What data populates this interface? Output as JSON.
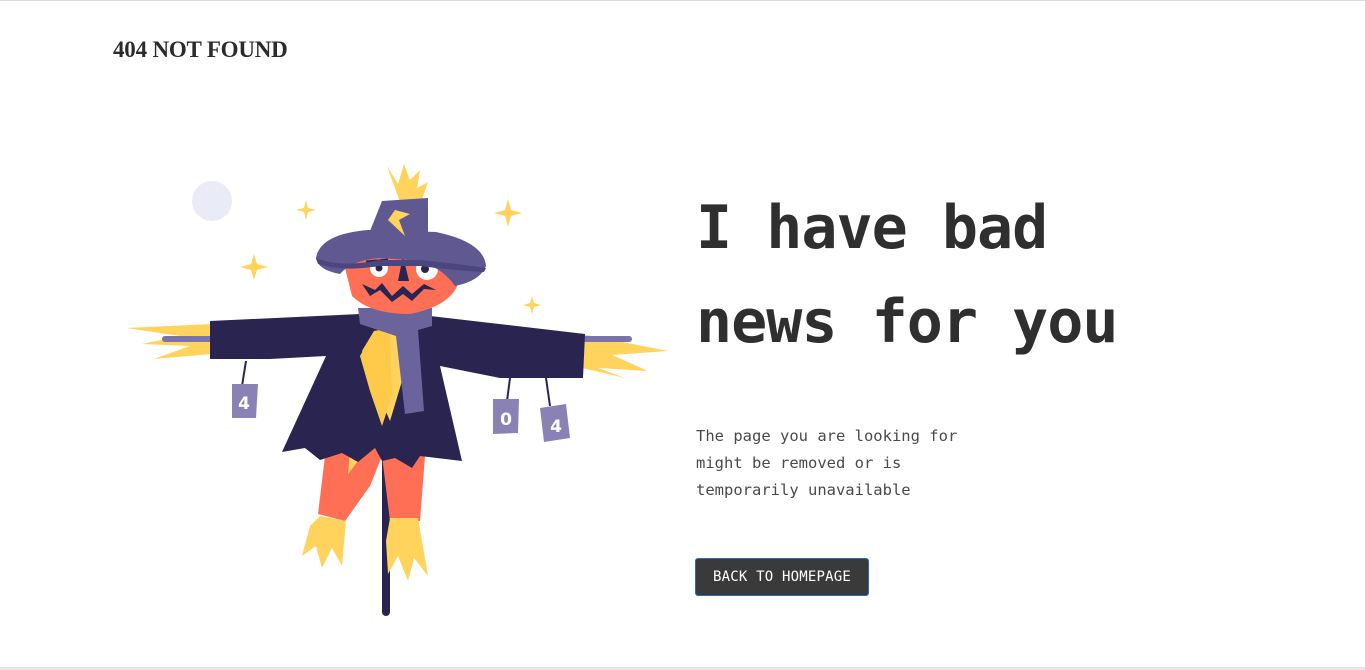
{
  "header": {
    "brand": "404 NOT FOUND"
  },
  "illustration": {
    "can_labels": [
      "4",
      "0",
      "4"
    ],
    "colors": {
      "coat": "#2a2450",
      "hat": "#5f5891",
      "scarf": "#6b649c",
      "face": "#ff6f56",
      "straw": "#ffd35c",
      "moon": "#e9ecf6",
      "can": "#8a82b4"
    }
  },
  "main": {
    "headline_line1": "I have bad",
    "headline_line2": "news for you",
    "description": "The page you are looking for might be removed or is temporarily unavailable",
    "button_label": "BACK TO HOMEPAGE"
  }
}
